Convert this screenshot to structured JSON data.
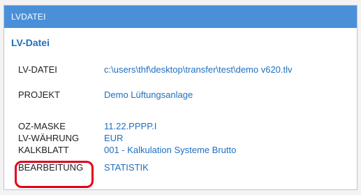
{
  "window": {
    "title": "LVDATEI"
  },
  "section": {
    "title": "LV-Datei"
  },
  "rows": [
    {
      "label": "LV-DATEI",
      "value": "c:\\users\\thf\\desktop\\transfer\\test\\demo v620.tlv"
    },
    {
      "label": "PROJEKT",
      "value": "Demo Lüftungsanlage"
    },
    {
      "label": "OZ-MASKE",
      "value": "11.22.PPPP.I"
    },
    {
      "label": "LV-WÄHRUNG",
      "value": "EUR"
    },
    {
      "label": "KALKBLATT",
      "value": "001 - Kalkulation Systeme Brutto"
    },
    {
      "label": "BEARBEITUNG",
      "value": "STATISTIK"
    }
  ],
  "colors": {
    "header_bg": "#4a90d9",
    "accent": "#1f6fbf",
    "annotation": "#e3001b"
  }
}
